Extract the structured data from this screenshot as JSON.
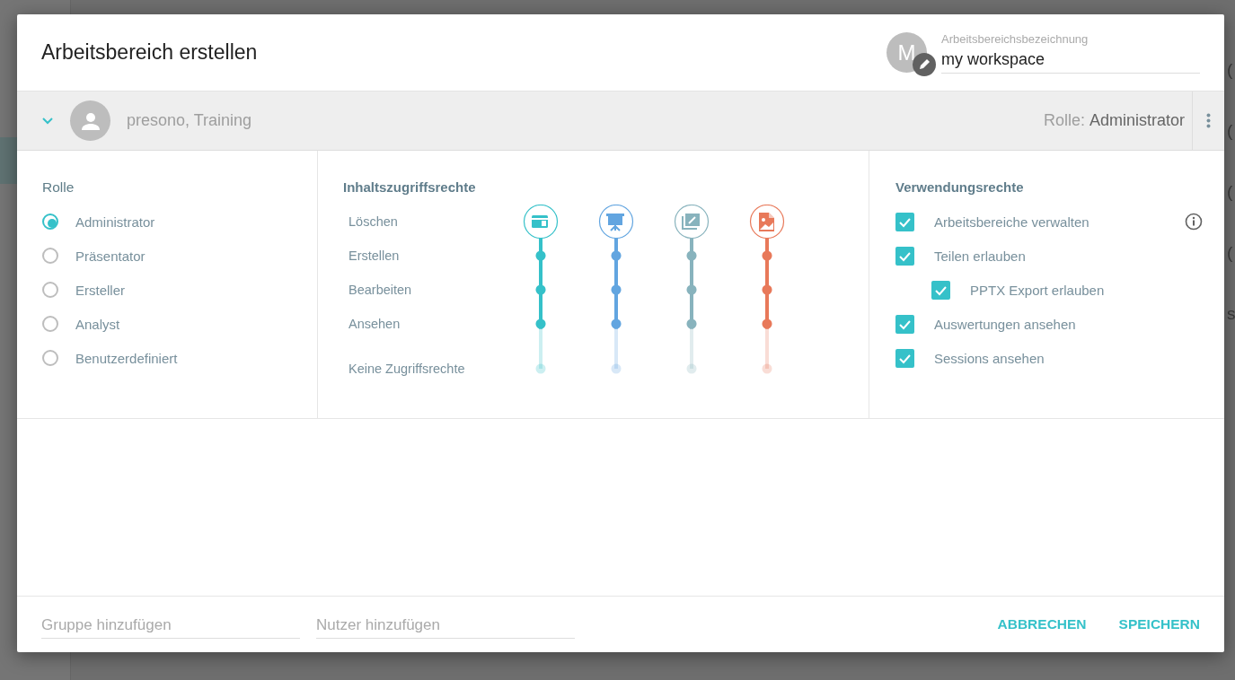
{
  "background": {
    "sidebar_item_selected": true,
    "fragments": [
      "(",
      "(",
      "(",
      "(",
      "s"
    ]
  },
  "dialog": {
    "title": "Arbeitsbereich erstellen",
    "workspace": {
      "avatar_letter": "M",
      "field_label": "Arbeitsbereichsbezeichnung",
      "value": "my workspace"
    },
    "member": {
      "expanded": true,
      "name": "presono, Training",
      "role_label": "Rolle:",
      "role_value": "Administrator"
    },
    "roles": {
      "title": "Rolle",
      "options": [
        {
          "label": "Administrator",
          "selected": true
        },
        {
          "label": "Präsentator",
          "selected": false
        },
        {
          "label": "Ersteller",
          "selected": false
        },
        {
          "label": "Analyst",
          "selected": false
        },
        {
          "label": "Benutzerdefiniert",
          "selected": false
        }
      ]
    },
    "content_rights": {
      "title": "Inhaltszugriffsrechte",
      "levels": [
        "Löschen",
        "Erstellen",
        "Bearbeiten",
        "Ansehen",
        "Keine Zugriffsrechte"
      ],
      "columns": [
        {
          "kind": "card",
          "color": "#35c1c9",
          "level": 1
        },
        {
          "kind": "easel",
          "color": "#62a5e0",
          "level": 1
        },
        {
          "kind": "image-edit",
          "color": "#88b3bd",
          "level": 1
        },
        {
          "kind": "image-file",
          "color": "#e8795a",
          "level": 1
        }
      ]
    },
    "usage_rights": {
      "title": "Verwendungsrechte",
      "items": [
        {
          "label": "Arbeitsbereiche verwalten",
          "checked": true,
          "info": true
        },
        {
          "label": "Teilen erlauben",
          "checked": true,
          "info": false,
          "children": [
            {
              "label": "PPTX Export erlauben",
              "checked": true,
              "info": false
            }
          ]
        },
        {
          "label": "Auswertungen ansehen",
          "checked": true,
          "info": false
        },
        {
          "label": "Sessions ansehen",
          "checked": true,
          "info": false
        }
      ]
    },
    "footer": {
      "fields": [
        {
          "placeholder": "Gruppe hinzufügen"
        },
        {
          "placeholder": "Nutzer hinzufügen"
        }
      ],
      "buttons": [
        "ABBRECHEN",
        "SPEICHERN"
      ]
    }
  }
}
